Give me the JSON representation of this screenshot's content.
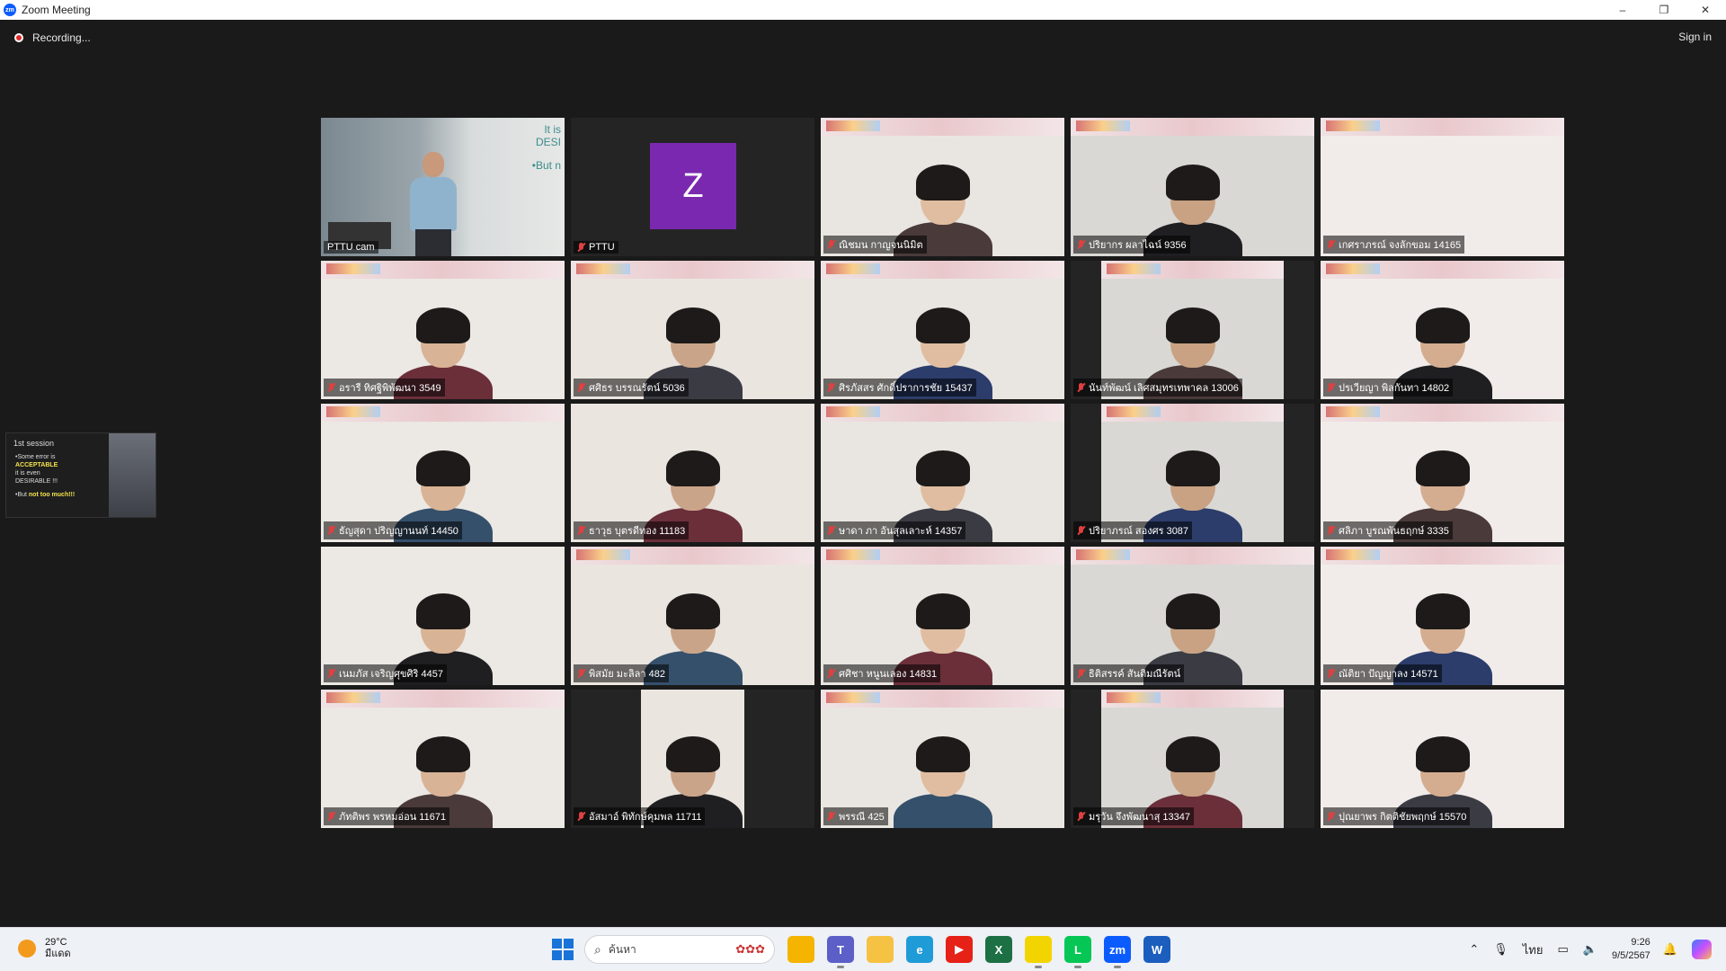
{
  "window": {
    "app_icon_text": "zm",
    "title": "Zoom Meeting",
    "controls": {
      "minimize": "–",
      "restore": "❐",
      "close": "✕"
    }
  },
  "meeting": {
    "recording_label": "Recording...",
    "sign_in_label": "Sign in"
  },
  "participants": [
    {
      "name": "PTTU cam",
      "muted": false,
      "kind": "video-presenter",
      "active": true
    },
    {
      "name": "PTTU",
      "muted": true,
      "kind": "avatar",
      "avatar_letter": "Z",
      "avatar_color": "#7b28b0"
    },
    {
      "name": "ณิชมน กาญจนนิมิต",
      "muted": true,
      "kind": "video"
    },
    {
      "name": "ปริยากร ผลาไฉน์ 9356",
      "muted": true,
      "kind": "video"
    },
    {
      "name": "เกศราภรณ์ จงลักขอม 14165",
      "muted": true,
      "kind": "video-empty"
    },
    {
      "name": "อรารี ทิศฐิพิพัฒนา 3549",
      "muted": true,
      "kind": "video"
    },
    {
      "name": "ศศิธร บรรณรัตน์ 5036",
      "muted": true,
      "kind": "video"
    },
    {
      "name": "ศิรภัสสร ศักดิ์ปราการชัย 15437",
      "muted": true,
      "kind": "video"
    },
    {
      "name": "นันท์พัฒน์ เลิศสมุทรเทพาคล 13006",
      "muted": true,
      "kind": "video-narrow"
    },
    {
      "name": "ปรเวียญา พิลกันทา 14802",
      "muted": true,
      "kind": "video"
    },
    {
      "name": "ธัญสุดา ปริญญานนท์ 14450",
      "muted": true,
      "kind": "video"
    },
    {
      "name": "ธาวุธ บุตรดีทอง 11183",
      "muted": true,
      "kind": "video"
    },
    {
      "name": "ษาดา  ภา  อันสุลเลาะห์ 14357",
      "muted": true,
      "kind": "video"
    },
    {
      "name": "ปริยาภรณ์ สองศร 3087",
      "muted": true,
      "kind": "video-narrow"
    },
    {
      "name": "ศลิภา บูรณพันธฤกษ์ 3335",
      "muted": true,
      "kind": "video"
    },
    {
      "name": "เนมภัส เจริญศุขศิริ 4457",
      "muted": true,
      "kind": "video"
    },
    {
      "name": "พิสมัย มะลิลา 482",
      "muted": true,
      "kind": "video"
    },
    {
      "name": "ศศิชา หนูนเลอง 14831",
      "muted": true,
      "kind": "video"
    },
    {
      "name": "ธิติสรรค์ สันติมณีรัตน์",
      "muted": true,
      "kind": "video"
    },
    {
      "name": "ณัติยา ปัญญาลง 14571",
      "muted": true,
      "kind": "video"
    },
    {
      "name": "ภัทติพร พรหมอ่อน 11671",
      "muted": true,
      "kind": "video"
    },
    {
      "name": "อัสมาอ์ พิทักษ์คุมพล 11711",
      "muted": true,
      "kind": "video-narrower"
    },
    {
      "name": "พรรณี 425",
      "muted": true,
      "kind": "video"
    },
    {
      "name": "มรุวัน จึงพัฒนาสุ 13347",
      "muted": true,
      "kind": "video-narrow"
    },
    {
      "name": "ปุณยาพร กิตติชัยพฤกษ์ 15570",
      "muted": true,
      "kind": "video"
    }
  ],
  "presenter_slide": {
    "line1": "It is",
    "line2": "DESI",
    "line3": "•But n"
  },
  "shared_thumb": {
    "session": "1st session",
    "lines": [
      "•Some error is",
      "ACCEPTABLE",
      "it is even",
      "DESIRABLE !!!"
    ],
    "footer_a": "•But ",
    "footer_b": "not too much!!!"
  },
  "taskbar": {
    "weather_temp": "29°C",
    "weather_desc": "มีแดด",
    "search_placeholder": "ค้นหา",
    "apps": [
      {
        "name": "file-explorer-icon",
        "label": "",
        "color": "#f4b400"
      },
      {
        "name": "teams-icon",
        "label": "T",
        "color": "#5b5fc7"
      },
      {
        "name": "folder-icon",
        "label": "",
        "color": "#f6c244"
      },
      {
        "name": "edge-icon",
        "label": "e",
        "color": "#1f9bd8"
      },
      {
        "name": "youtube-icon",
        "label": "▶",
        "color": "#e62117"
      },
      {
        "name": "excel-icon",
        "label": "X",
        "color": "#1d7044"
      },
      {
        "name": "sticky-notes-icon",
        "label": "",
        "color": "#f2d500"
      },
      {
        "name": "line-icon",
        "label": "L",
        "color": "#06c755"
      },
      {
        "name": "zoom-icon",
        "label": "zm",
        "color": "#0b5cff"
      },
      {
        "name": "word-icon",
        "label": "W",
        "color": "#1b5ebe"
      }
    ],
    "language": "ไทย",
    "time": "9:26",
    "date": "9/5/2567"
  }
}
